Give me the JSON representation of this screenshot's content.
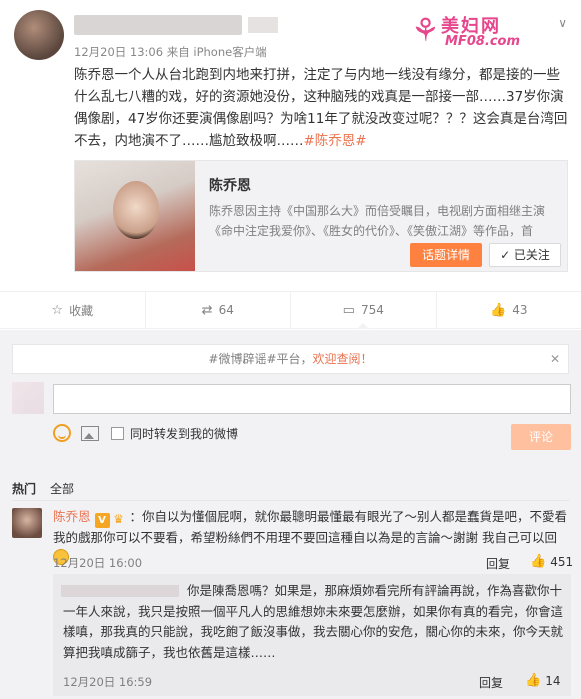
{
  "post": {
    "time": "12月20日 13:06",
    "source_prefix": "来自",
    "source": "iPhone客户端",
    "text": "陈乔恩一个人从台北跑到内地来打拼，注定了与内地一线没有缘分，都是接的一些什么乱七八糟的戏，好的资源她没份，这种脑残的戏真是一部接一部……37岁你演偶像剧，47岁你还要演偶像剧吗？为啥11年了就没改变过呢？？？这会真是台湾回不去，内地演不了……尴尬致极啊……",
    "hashtag": "#陈乔恩#"
  },
  "watermark": {
    "figure": "⚘",
    "title": "美妇网",
    "url": "MF08.com"
  },
  "card": {
    "title": "陈乔恩",
    "desc_line1": "陈乔恩因主持《中国那么大》而倍受瞩目，电视剧方面相继主演",
    "desc_line2": "《命中注定我爱你》、《胜女的代价》、《笑傲江湖》等作品，首",
    "topic_button": "话题详情",
    "follow_button": "✓ 已关注"
  },
  "actions": {
    "favorite": "收藏",
    "repost": "64",
    "comment": "754",
    "like": "43"
  },
  "comments": {
    "notice_prefix": "#微博辟谣#平台，",
    "notice_highlight": "欢迎查阅！",
    "sync_label": "同时转发到我的微博",
    "submit": "评论",
    "filter_hot": "热门",
    "filter_all": "全部",
    "top": {
      "name": "陈乔恩",
      "text": "：你自以为懂個屁啊，就你最聰明最懂最有眼光了～别人都是蠢貨是吧，不愛看我的戲那你可以不要看，希望粉絲們不用理不要回這種自以為是的言論～謝謝 我自己可以回",
      "time": "12月20日 16:00",
      "reply": "回复",
      "likes": "451"
    },
    "sub": {
      "text": "你是陳喬恩嗎？如果是，那麻煩妳看完所有評論再說，作為喜歡你十一年人來說，我只是按照一個平凡人的思維想妳未來要怎麼辦，如果你有真的看完，你會這樣嗔，那我真的只能說，我吃飽了飯沒事做，我去關心你的安危，關心你的未來，你今天就算把我嗔成篩子，我也依舊是這樣……",
      "time": "12月20日 16:59",
      "reply": "回复",
      "likes": "14"
    }
  }
}
